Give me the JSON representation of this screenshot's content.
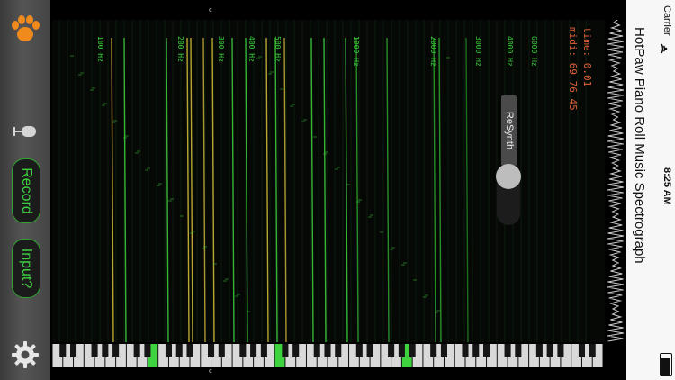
{
  "app": {
    "title": "HotPaw Piano Roll Music Spectrograph"
  },
  "status_bar": {
    "carrier": "Carrier",
    "time": "8:25 AM"
  },
  "controls": {
    "record_label": "Record",
    "input_label": "Input?",
    "resynth_label": "ReSynth"
  },
  "readouts": {
    "time": "time: 0.01",
    "midi": "midi: 69 76 45"
  },
  "frequency_axis": {
    "labels": [
      "100 Hz",
      "200 Hz",
      "300 Hz",
      "400 Hz",
      "500 Hz",
      "1000 Hz",
      "2000 Hz",
      "3000 Hz",
      "4000 Hz",
      "6000 Hz"
    ]
  },
  "keyboard": {
    "octave_marker": "c",
    "highlighted_keys": [
      9,
      21,
      33
    ]
  },
  "icons": {
    "logo": "paw-icon",
    "microphone": "microphone-icon",
    "settings": "gear-icon",
    "wifi": "wifi-icon",
    "battery": "battery-icon"
  },
  "colors": {
    "accent_green": "#3fd23f",
    "readout_orange": "#e0603a",
    "trace_yellow": "#d8c23a"
  }
}
